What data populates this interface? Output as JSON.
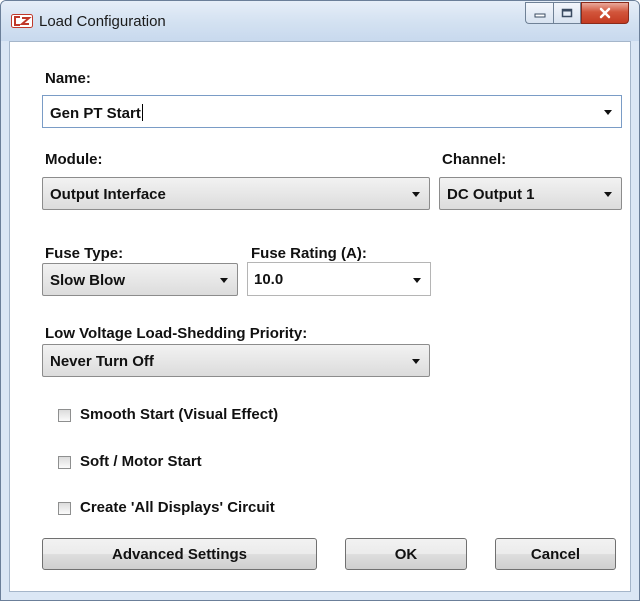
{
  "window": {
    "title": "Load Configuration"
  },
  "name": {
    "label": "Name:",
    "value": "Gen PT Start"
  },
  "module": {
    "label": "Module:",
    "value": "Output Interface"
  },
  "channel": {
    "label": "Channel:",
    "value": "DC Output 1"
  },
  "fuse_type": {
    "label": "Fuse Type:",
    "value": "Slow Blow"
  },
  "fuse_rating": {
    "label": "Fuse Rating (A):",
    "value": "10.0"
  },
  "priority": {
    "label": "Low Voltage Load-Shedding Priority:",
    "value": "Never Turn Off"
  },
  "checkboxes": [
    {
      "label": "Smooth Start (Visual Effect)",
      "checked": false
    },
    {
      "label": "Soft / Motor Start",
      "checked": false
    },
    {
      "label": "Create 'All Displays' Circuit",
      "checked": false
    }
  ],
  "buttons": {
    "advanced": "Advanced Settings",
    "ok": "OK",
    "cancel": "Cancel"
  },
  "icons": {
    "app": "load-config-app-icon",
    "minimize": "minimize-icon",
    "maximize": "maximize-icon",
    "close": "close-icon",
    "dropdown": "chevron-down-icon"
  },
  "colors": {
    "close_button": "#c43a21",
    "titlebar": "#d3e1f1"
  }
}
